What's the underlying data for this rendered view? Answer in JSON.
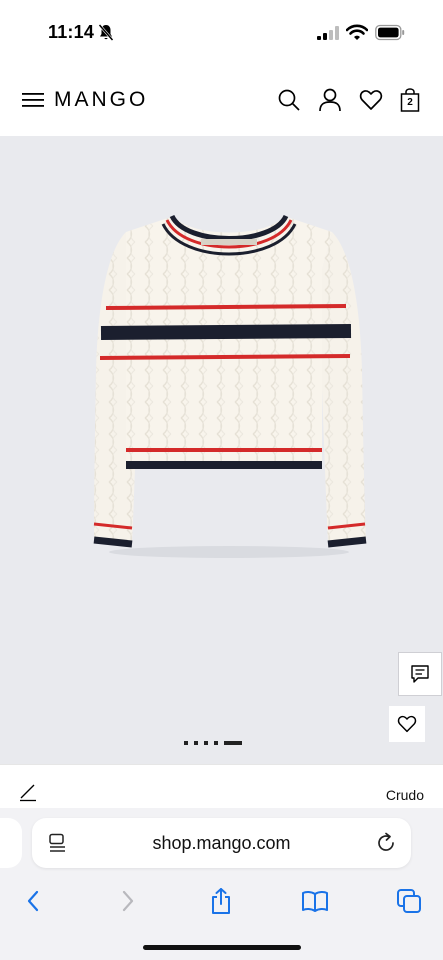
{
  "status": {
    "time": "11:14"
  },
  "header": {
    "brand": "MANGO",
    "cart_count": "2"
  },
  "gallery": {
    "dot_count": 5,
    "active_dot": 4
  },
  "color": {
    "name": "Crudo"
  },
  "browser": {
    "url": "shop.mango.com"
  },
  "colors": {
    "red": "#d42a2a",
    "navy": "#1b1f2e",
    "cream": "#f6f2ea",
    "gallery_bg": "#e9eaee",
    "link_blue": "#1a73e8"
  }
}
